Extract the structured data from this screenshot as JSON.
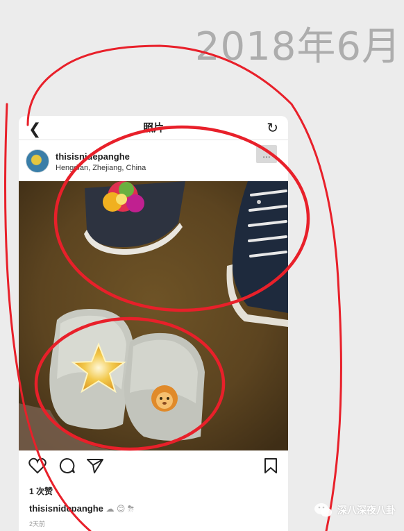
{
  "date_header": "2018年6月",
  "nav": {
    "back_icon": "chevron-left-icon",
    "title": "照片",
    "refresh_icon": "refresh-icon"
  },
  "post": {
    "username": "thisisnidepanghe",
    "location": "Hengdian, Zhejiang, China",
    "more_label": "...",
    "likes": "1 次赞",
    "caption_user": "thisisnidepanghe",
    "caption_emojis": "☁ 😊 ⛈",
    "time_ago": "2天前"
  },
  "watermark": "深八深夜八卦",
  "colors": {
    "annotation_red": "#e8202a",
    "background": "#ececec",
    "date_gray": "#adadad"
  },
  "icons": [
    "heart-icon",
    "comment-icon",
    "share-icon",
    "bookmark-icon",
    "wechat-logo-icon"
  ]
}
